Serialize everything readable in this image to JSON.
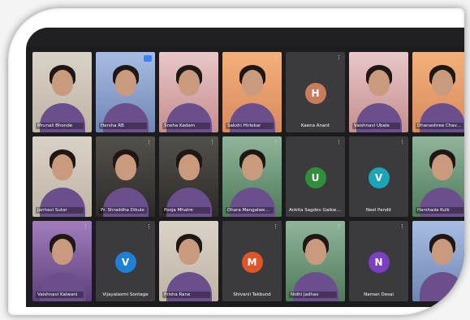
{
  "meeting": {
    "view": "gallery",
    "tiles": [
      {
        "name": "Mrunali Bhonde",
        "type": "video",
        "style": "bright"
      },
      {
        "name": "Harsha RB",
        "type": "video",
        "style": "blue",
        "speaking": true
      },
      {
        "name": "Sneha Kadam",
        "type": "video",
        "style": "pink"
      },
      {
        "name": "Sakshi Hirlekar",
        "type": "video",
        "style": "peach"
      },
      {
        "name": "Kaena Anant",
        "type": "avatar",
        "initial": "H",
        "color": "#c87d5a"
      },
      {
        "name": "Vaishnavi Ubale",
        "type": "video",
        "style": "pink"
      },
      {
        "name": "Dhanashree Chavan",
        "type": "video",
        "style": "peach"
      },
      {
        "name": "Janhavi Sutar",
        "type": "video",
        "style": "bright"
      },
      {
        "name": "Pr. Shraddha Dikule",
        "type": "video",
        "style": "dim"
      },
      {
        "name": "Pooja Mhatre",
        "type": "video",
        "style": "dim"
      },
      {
        "name": "Dhara Mangalwedhe",
        "type": "video",
        "style": "green"
      },
      {
        "name": "Ankita Sagdev Gaikwad",
        "type": "avatar",
        "initial": "U",
        "color": "#2f8f3a"
      },
      {
        "name": "Neel Pandit",
        "type": "avatar",
        "initial": "V",
        "color": "#1aa6b7"
      },
      {
        "name": "Harshada Kulk",
        "type": "video",
        "style": "green"
      },
      {
        "name": "Vaishnavi Kalwani",
        "type": "video",
        "style": "purple"
      },
      {
        "name": "Vijayalaxmi Sontage",
        "type": "avatar",
        "initial": "V",
        "color": "#1e7fd6"
      },
      {
        "name": "Prisha Rane",
        "type": "video",
        "style": "bright"
      },
      {
        "name": "Shivanii Takbund",
        "type": "avatar",
        "initial": "M",
        "color": "#e0542a"
      },
      {
        "name": "Nidhi Jadhav",
        "type": "video",
        "style": "green"
      },
      {
        "name": "Naman Desai",
        "type": "avatar",
        "initial": "N",
        "color": "#7b3fc4"
      },
      {
        "name": "",
        "type": "video",
        "style": "blue"
      }
    ]
  }
}
